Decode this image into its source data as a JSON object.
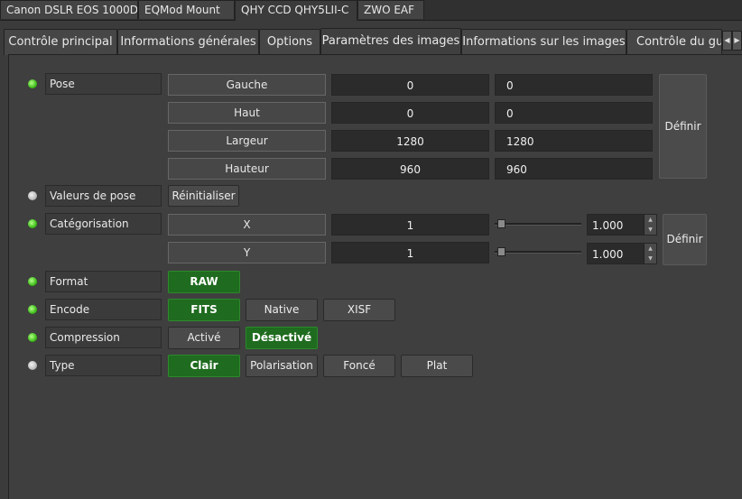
{
  "device_tabs": [
    {
      "label": "Canon DSLR EOS 1000D"
    },
    {
      "label": "EQMod Mount"
    },
    {
      "label": "QHY CCD QHY5LII-C"
    },
    {
      "label": "ZWO EAF"
    }
  ],
  "panel_tabs": [
    {
      "label": "Contrôle principal"
    },
    {
      "label": "Informations générales"
    },
    {
      "label": "Options"
    },
    {
      "label": "Paramètres des images"
    },
    {
      "label": "Informations sur les images"
    },
    {
      "label": "Contrôle du guid"
    }
  ],
  "scroll_left_icon": "◀",
  "scroll_right_icon": "▶",
  "pose": {
    "label": "Pose",
    "fields": [
      {
        "name": "Gauche",
        "value": "0",
        "input": "0"
      },
      {
        "name": "Haut",
        "value": "0",
        "input": "0"
      },
      {
        "name": "Largeur",
        "value": "1280",
        "input": "1280"
      },
      {
        "name": "Hauteur",
        "value": "960",
        "input": "960"
      }
    ],
    "set_label": "Définir"
  },
  "valeurs_pose": {
    "label": "Valeurs de pose",
    "reset_label": "Réinitialiser"
  },
  "binning": {
    "label": "Catégorisation",
    "rows": [
      {
        "name": "X",
        "value": "1",
        "spin": "1.000"
      },
      {
        "name": "Y",
        "value": "1",
        "spin": "1.000"
      }
    ],
    "set_label": "Définir"
  },
  "format": {
    "label": "Format",
    "options": [
      "RAW"
    ]
  },
  "encode": {
    "label": "Encode",
    "options": [
      "FITS",
      "Native",
      "XISF"
    ]
  },
  "compression": {
    "label": "Compression",
    "options": [
      "Activé",
      "Désactivé"
    ]
  },
  "type": {
    "label": "Type",
    "options": [
      "Clair",
      "Polarisation",
      "Foncé",
      "Plat"
    ]
  },
  "colors": {
    "led_ok": "#3fbf1a",
    "led_idle": "#bcbcbc",
    "active_button": "#1f6b1f"
  }
}
